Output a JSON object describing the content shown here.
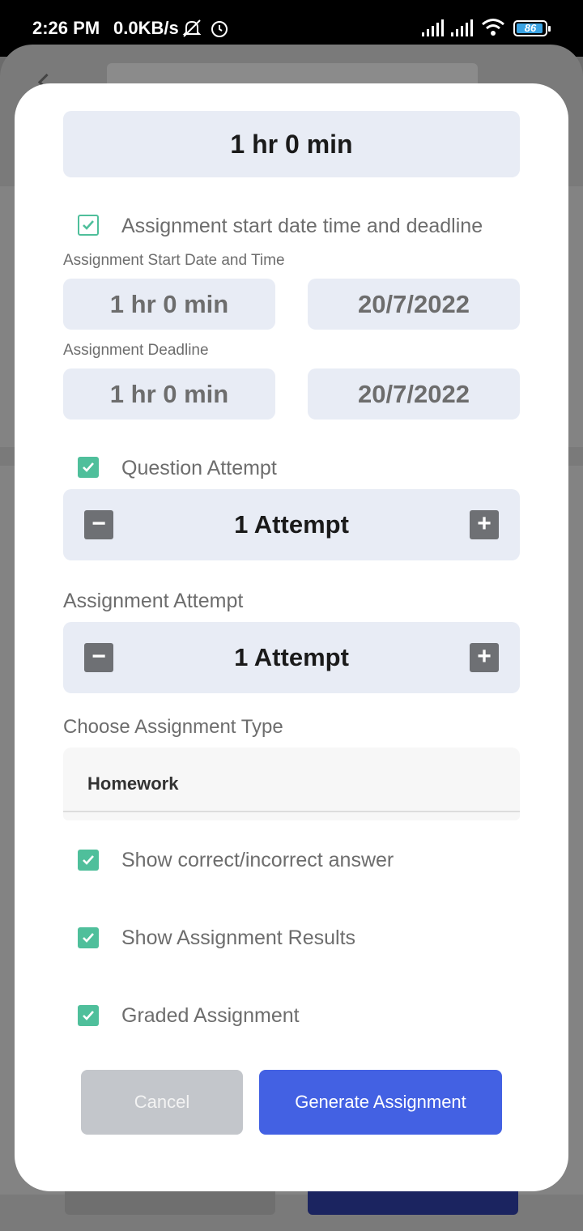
{
  "status_bar": {
    "time": "2:26 PM",
    "speed": "0.0KB/s",
    "battery": "86"
  },
  "modal": {
    "duration": "1 hr 0 min",
    "start_deadline_checkbox": "Assignment start date time and deadline",
    "start_label": "Assignment Start Date and Time",
    "start_time": "1 hr 0 min",
    "start_date": "20/7/2022",
    "deadline_label": "Assignment Deadline",
    "deadline_time": "1 hr 0 min",
    "deadline_date": "20/7/2022",
    "question_attempt_label": "Question Attempt",
    "question_attempt_value": "1 Attempt",
    "assignment_attempt_label": "Assignment Attempt",
    "assignment_attempt_value": "1 Attempt",
    "type_label": "Choose Assignment Type",
    "type_value": "Homework",
    "show_correct": "Show correct/incorrect answer",
    "show_results": "Show Assignment Results",
    "graded": "Graded Assignment",
    "cancel": "Cancel",
    "generate": "Generate Assignment"
  },
  "colors": {
    "accent": "#4361e3",
    "checkbox": "#4fbf9b",
    "field_bg": "#e8ecf5"
  }
}
